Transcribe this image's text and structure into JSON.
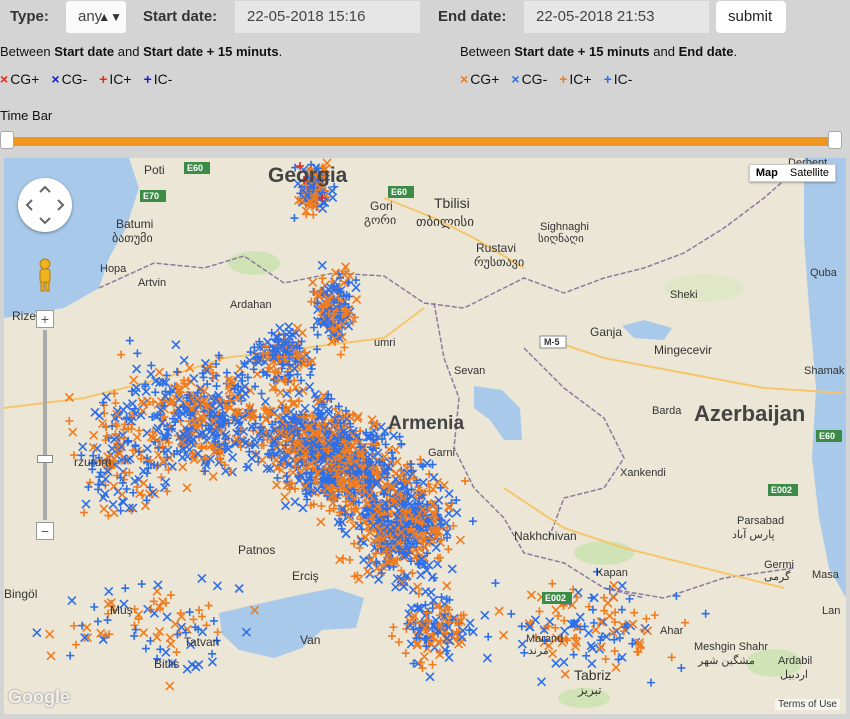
{
  "filters": {
    "type_label": "Type:",
    "type_value": "any",
    "start_label": "Start date:",
    "start_value": "22-05-2018 15:16",
    "end_label": "End date:",
    "end_value": "22-05-2018 21:53",
    "submit_label": "submit"
  },
  "notes": {
    "left": {
      "t1": "Between ",
      "b1": "Start date",
      "t2": " and ",
      "b2": "Start date + 15 minuts",
      "t3": "."
    },
    "right": {
      "t1": "Between ",
      "b1": "Start date + 15 minuts",
      "t2": " and ",
      "b2": "End date",
      "t3": "."
    }
  },
  "legend_left": [
    {
      "symbol": "×",
      "label": "CG+",
      "color": "#e8261c"
    },
    {
      "symbol": "×",
      "label": "CG-",
      "color": "#1a1acc"
    },
    {
      "symbol": "+",
      "label": "IC+",
      "color": "#e8261c"
    },
    {
      "symbol": "+",
      "label": "IC-",
      "color": "#1a1acc"
    }
  ],
  "legend_right": [
    {
      "symbol": "×",
      "label": "CG+",
      "color": "#f07c1e"
    },
    {
      "symbol": "×",
      "label": "CG-",
      "color": "#2e6fe8"
    },
    {
      "symbol": "+",
      "label": "IC+",
      "color": "#f07c1e"
    },
    {
      "symbol": "+",
      "label": "IC-",
      "color": "#2e6fe8"
    }
  ],
  "timebar": {
    "label": "Time Bar",
    "range": [
      0,
      1
    ]
  },
  "map": {
    "type_map": "Map",
    "type_satellite": "Satellite",
    "terms": "Terms of Use",
    "logo": "Google",
    "labels": {
      "georgia": "Georgia",
      "armenia": "Armenia",
      "azerbaijan": "Azerbaijan",
      "tbilisi": "Tbilisi",
      "tbilisi_ka": "თბილისი",
      "batumi": "Batumi",
      "batumi_ka": "ბათუმი",
      "poti": "Poti",
      "gori": "Gori",
      "gori_ka": "გორი",
      "rustavi": "Rustavi",
      "rustavi_ka": "რუსთავი",
      "sighnaghi": "Sighnaghi",
      "sighnaghi_ka": "სიღნაღი",
      "derbent": "Derbent",
      "quba": "Quba",
      "sheki": "Sheki",
      "ganja": "Ganja",
      "mingecevir": "Mingecevir",
      "shamak": "Shamak",
      "barda": "Barda",
      "xankendi": "Xankendi",
      "parsabad": "Parsabad",
      "parsabad_fa": "پارس آباد",
      "germi": "Germi",
      "germi_fa": "گرمی",
      "masa": "Masa",
      "lan": "Lan",
      "nakhchivan": "Nakhchivan",
      "kapan": "Kapan",
      "marand": "Marand",
      "marand_fa": "مرند",
      "ahar": "Ahar",
      "meshgin": "Meshgin Shahr",
      "meshgin_fa": "مشگین شهر",
      "ardabil": "Ardabil",
      "ardabil_fa": "اردبیل",
      "tabriz": "Tabriz",
      "tabriz_fa": "تبریز",
      "van": "Van",
      "tatvan": "Tatvan",
      "bitlis": "Bitlis",
      "mus": "Muş",
      "bingol": "Bingöl",
      "patnos": "Patnos",
      "ercis": "Erciş",
      "erzurum": "rzurum",
      "rize": "Rize",
      "hopa": "Hopa",
      "artvin": "Artvin",
      "ardahan": "Ardahan",
      "gyumri": "umri",
      "sevan": "Sevan",
      "garni": "Garni",
      "m5": "M-5",
      "e60a": "E60",
      "e60b": "E60",
      "e60c": "E60",
      "e70": "E70",
      "e002a": "E002",
      "e002b": "E002"
    }
  },
  "colors": {
    "orange": "#f07c1e",
    "blue": "#2e6fe8",
    "track": "#f0951e",
    "water": "#a9c9ea"
  }
}
